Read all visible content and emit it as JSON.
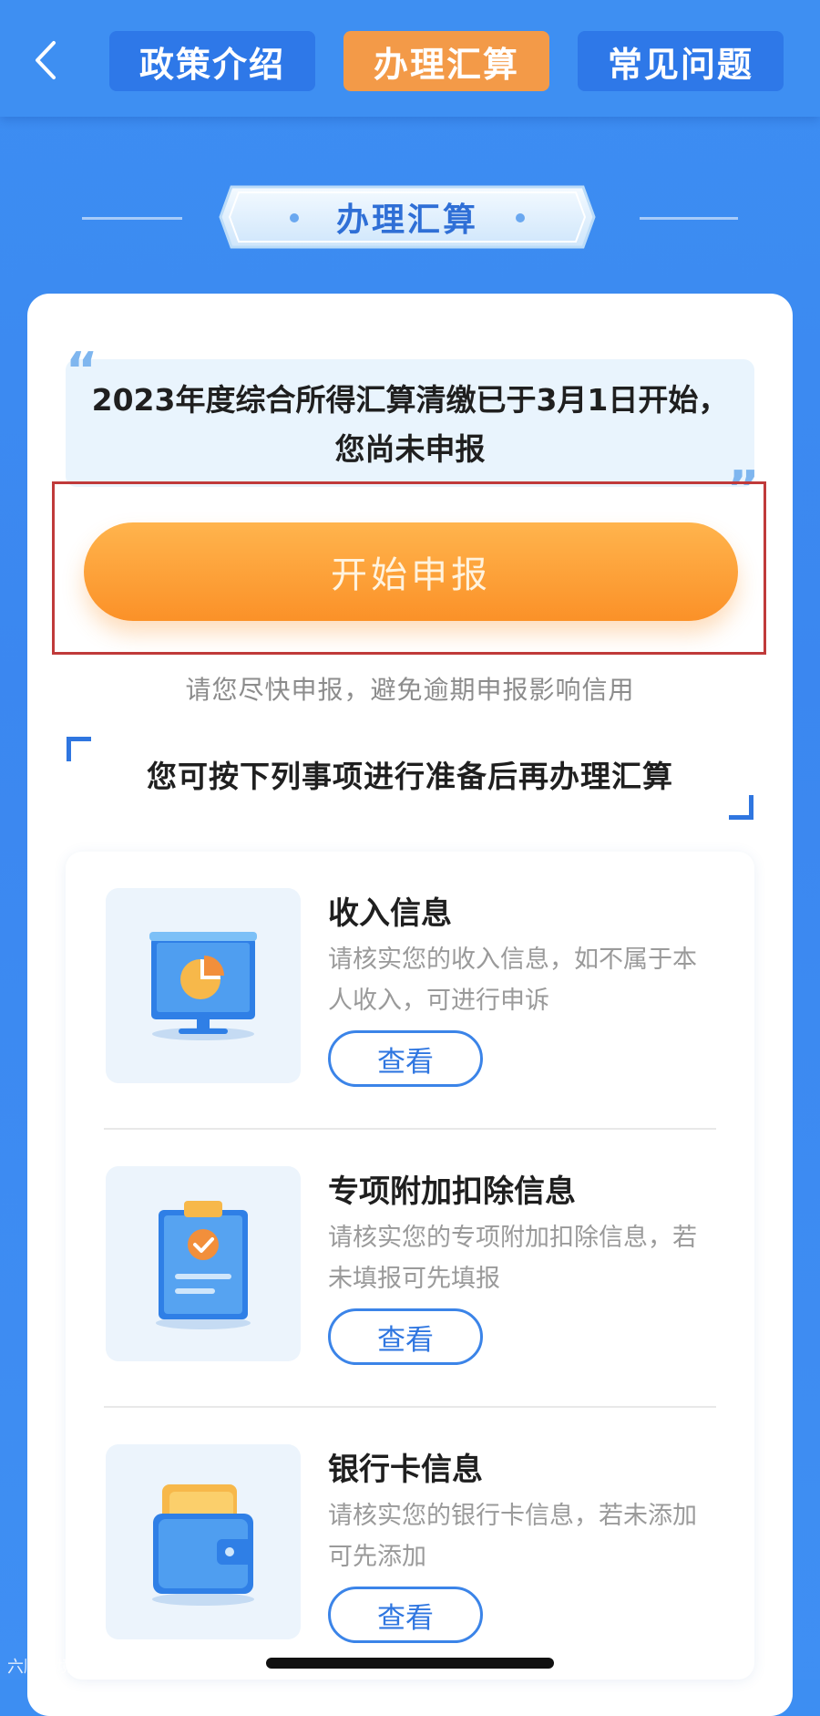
{
  "nav": {
    "tabs": [
      {
        "label": "政策介绍",
        "active": false
      },
      {
        "label": "办理汇算",
        "active": true
      },
      {
        "label": "常见问题",
        "active": false
      }
    ]
  },
  "section": {
    "title": "办理汇算"
  },
  "notice": {
    "text": "2023年度综合所得汇算清缴已于3月1日开始，您尚未申报"
  },
  "start_button": {
    "label": "开始申报"
  },
  "hint": "请您尽快申报，避免逾期申报影响信用",
  "prep_title": "您可按下列事项进行准备后再办理汇算",
  "items": [
    {
      "title": "收入信息",
      "desc": "请核实您的收入信息，如不属于本人收入，可进行申诉",
      "button": "查看",
      "icon": "chart-monitor-icon"
    },
    {
      "title": "专项附加扣除信息",
      "desc": "请核实您的专项附加扣除信息，若未填报可先填报",
      "button": "查看",
      "icon": "clipboard-check-icon"
    },
    {
      "title": "银行卡信息",
      "desc": "请核实您的银行卡信息，若未添加可先添加",
      "button": "查看",
      "icon": "wallet-icon"
    }
  ],
  "watermark": "六顺跨境",
  "colors": {
    "primary": "#3e8ff2",
    "accent": "#f39a48",
    "highlight_border": "#c03a3a"
  }
}
